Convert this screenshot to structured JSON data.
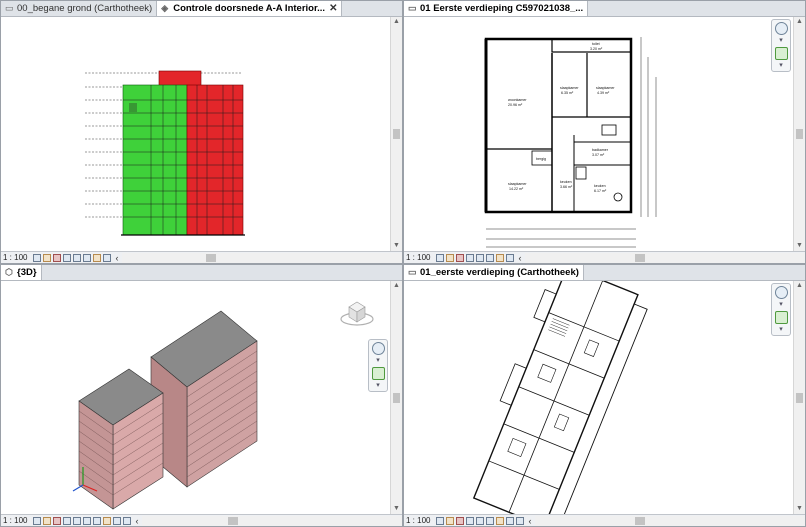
{
  "panes": [
    {
      "tabs": [
        {
          "label": "00_begane grond (Carthotheek)",
          "active": false,
          "closable": false
        },
        {
          "label": "Controle doorsnede A-A Interior...",
          "active": true,
          "closable": true
        }
      ],
      "scale": "1 : 100"
    },
    {
      "tabs": [
        {
          "label": "01 Eerste verdieping C597021038_...",
          "active": false,
          "closable": false
        }
      ],
      "scale": "1 : 100",
      "rooms": [
        {
          "name": "toilet",
          "area": "3.20 m²"
        },
        {
          "name": "woonkamer",
          "area": "20.96 m²"
        },
        {
          "name": "slaapkamer",
          "area": "6.35 m²"
        },
        {
          "name": "slaapkamer",
          "area": "4.39 m²"
        },
        {
          "name": "slaapkamer",
          "area": "14.22 m²"
        },
        {
          "name": "keuken",
          "area": "3.66 m²"
        },
        {
          "name": "badkamer",
          "area": "3.07 m²"
        },
        {
          "name": "keuken",
          "area": "6.17 m²"
        },
        {
          "name": "bergig",
          "area": ""
        }
      ]
    },
    {
      "tabs": [
        {
          "label": "{3D}",
          "active": false,
          "closable": false
        }
      ],
      "scale": "1 : 100"
    },
    {
      "tabs": [
        {
          "label": "01_eerste verdieping (Carthotheek)",
          "active": false,
          "closable": false
        }
      ],
      "scale": "1 : 100"
    }
  ],
  "icons": {
    "view_tab": "floorplan-icon",
    "section_tab": "section-icon",
    "threed_tab": "cube-icon",
    "close": "close-icon",
    "zoom": "zoom-icon",
    "pan": "pan-icon",
    "steering": "steering-wheel-icon",
    "chevron": "chevron-left-icon"
  },
  "colors": {
    "green_elements": "#3fd13a",
    "red_elements": "#e3262a",
    "building_roof": "#8a8a8a",
    "brick_facade": "#d9a9a9"
  }
}
